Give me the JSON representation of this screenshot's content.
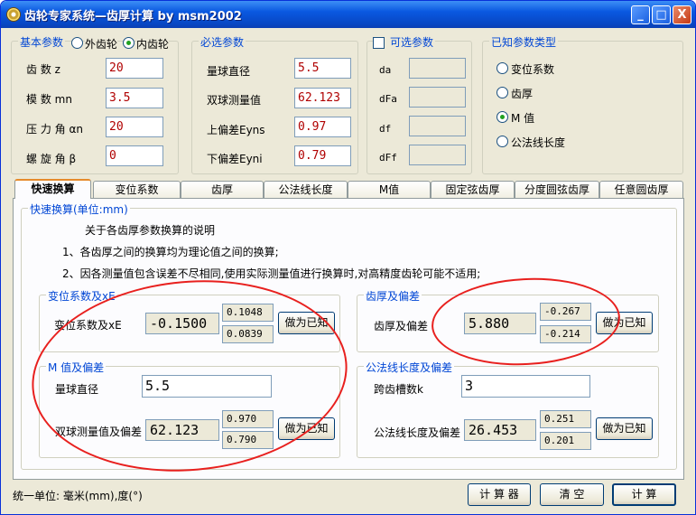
{
  "window": {
    "title": "齿轮专家系统—齿厚计算 by msm2002",
    "min": "_",
    "max": "□",
    "close": "X"
  },
  "basic": {
    "title": "基本参数",
    "outer": "外齿轮",
    "inner": "内齿轮",
    "z_label": "齿    数 z",
    "z": "20",
    "mn_label": "模    数 mn",
    "mn": "3.5",
    "alpha_label": "压 力 角 αn",
    "alpha": "20",
    "beta_label": "螺 旋 角 β",
    "beta": "0"
  },
  "required": {
    "title": "必选参数",
    "ball_label": "量球直径",
    "ball": "5.5",
    "m_label": "双球测量值",
    "m": "62.123",
    "eyns_label": "上偏差Eyns",
    "eyns": "0.97",
    "eyni_label": "下偏差Eyni",
    "eyni": "0.79"
  },
  "optional": {
    "title": "可选参数",
    "da": "da",
    "dfa": "dFa",
    "df": "df",
    "dff": "dFf"
  },
  "known": {
    "title": "已知参数类型",
    "opt1": "变位系数",
    "opt2": "齿厚",
    "opt3": "M 值",
    "opt4": "公法线长度"
  },
  "tabs": [
    "快速换算",
    "变位系数",
    "齿厚",
    "公法线长度",
    "M值",
    "固定弦齿厚",
    "分度圆弦齿厚",
    "任意圆齿厚"
  ],
  "quick": {
    "title": "快速换算(单位:mm)",
    "note_title": "关于各齿厚参数换算的说明",
    "note1": "1、各齿厚之间的换算均为理论值之间的换算;",
    "note2": "2、因各测量值包含误差不尽相同,使用实际测量值进行换算时,对高精度齿轮可能不适用;",
    "shift": {
      "title": "变位系数及xE",
      "label": "变位系数及xE",
      "value": "-0.1500",
      "dev_up": "0.1048",
      "dev_dn": "0.0839",
      "btn": "做为已知"
    },
    "thick": {
      "title": "齿厚及偏差",
      "label": "齿厚及偏差",
      "value": "5.880",
      "dev_up": "-0.267",
      "dev_dn": "-0.214",
      "btn": "做为已知"
    },
    "mval": {
      "title": "M 值及偏差",
      "ball_label": "量球直径",
      "ball": "5.5",
      "label": "双球测量值及偏差",
      "value": "62.123",
      "dev_up": "0.970",
      "dev_dn": "0.790",
      "btn": "做为已知"
    },
    "wlen": {
      "title": "公法线长度及偏差",
      "k_label": "跨齿槽数k",
      "k": "3",
      "label": "公法线长度及偏差",
      "value": "26.453",
      "dev_up": "0.251",
      "dev_dn": "0.201",
      "btn": "做为已知"
    }
  },
  "footer": {
    "units": "统一单位: 毫米(mm),度(°)",
    "calc_tool": "计 算 器",
    "clear": "清  空",
    "compute": "计  算"
  }
}
